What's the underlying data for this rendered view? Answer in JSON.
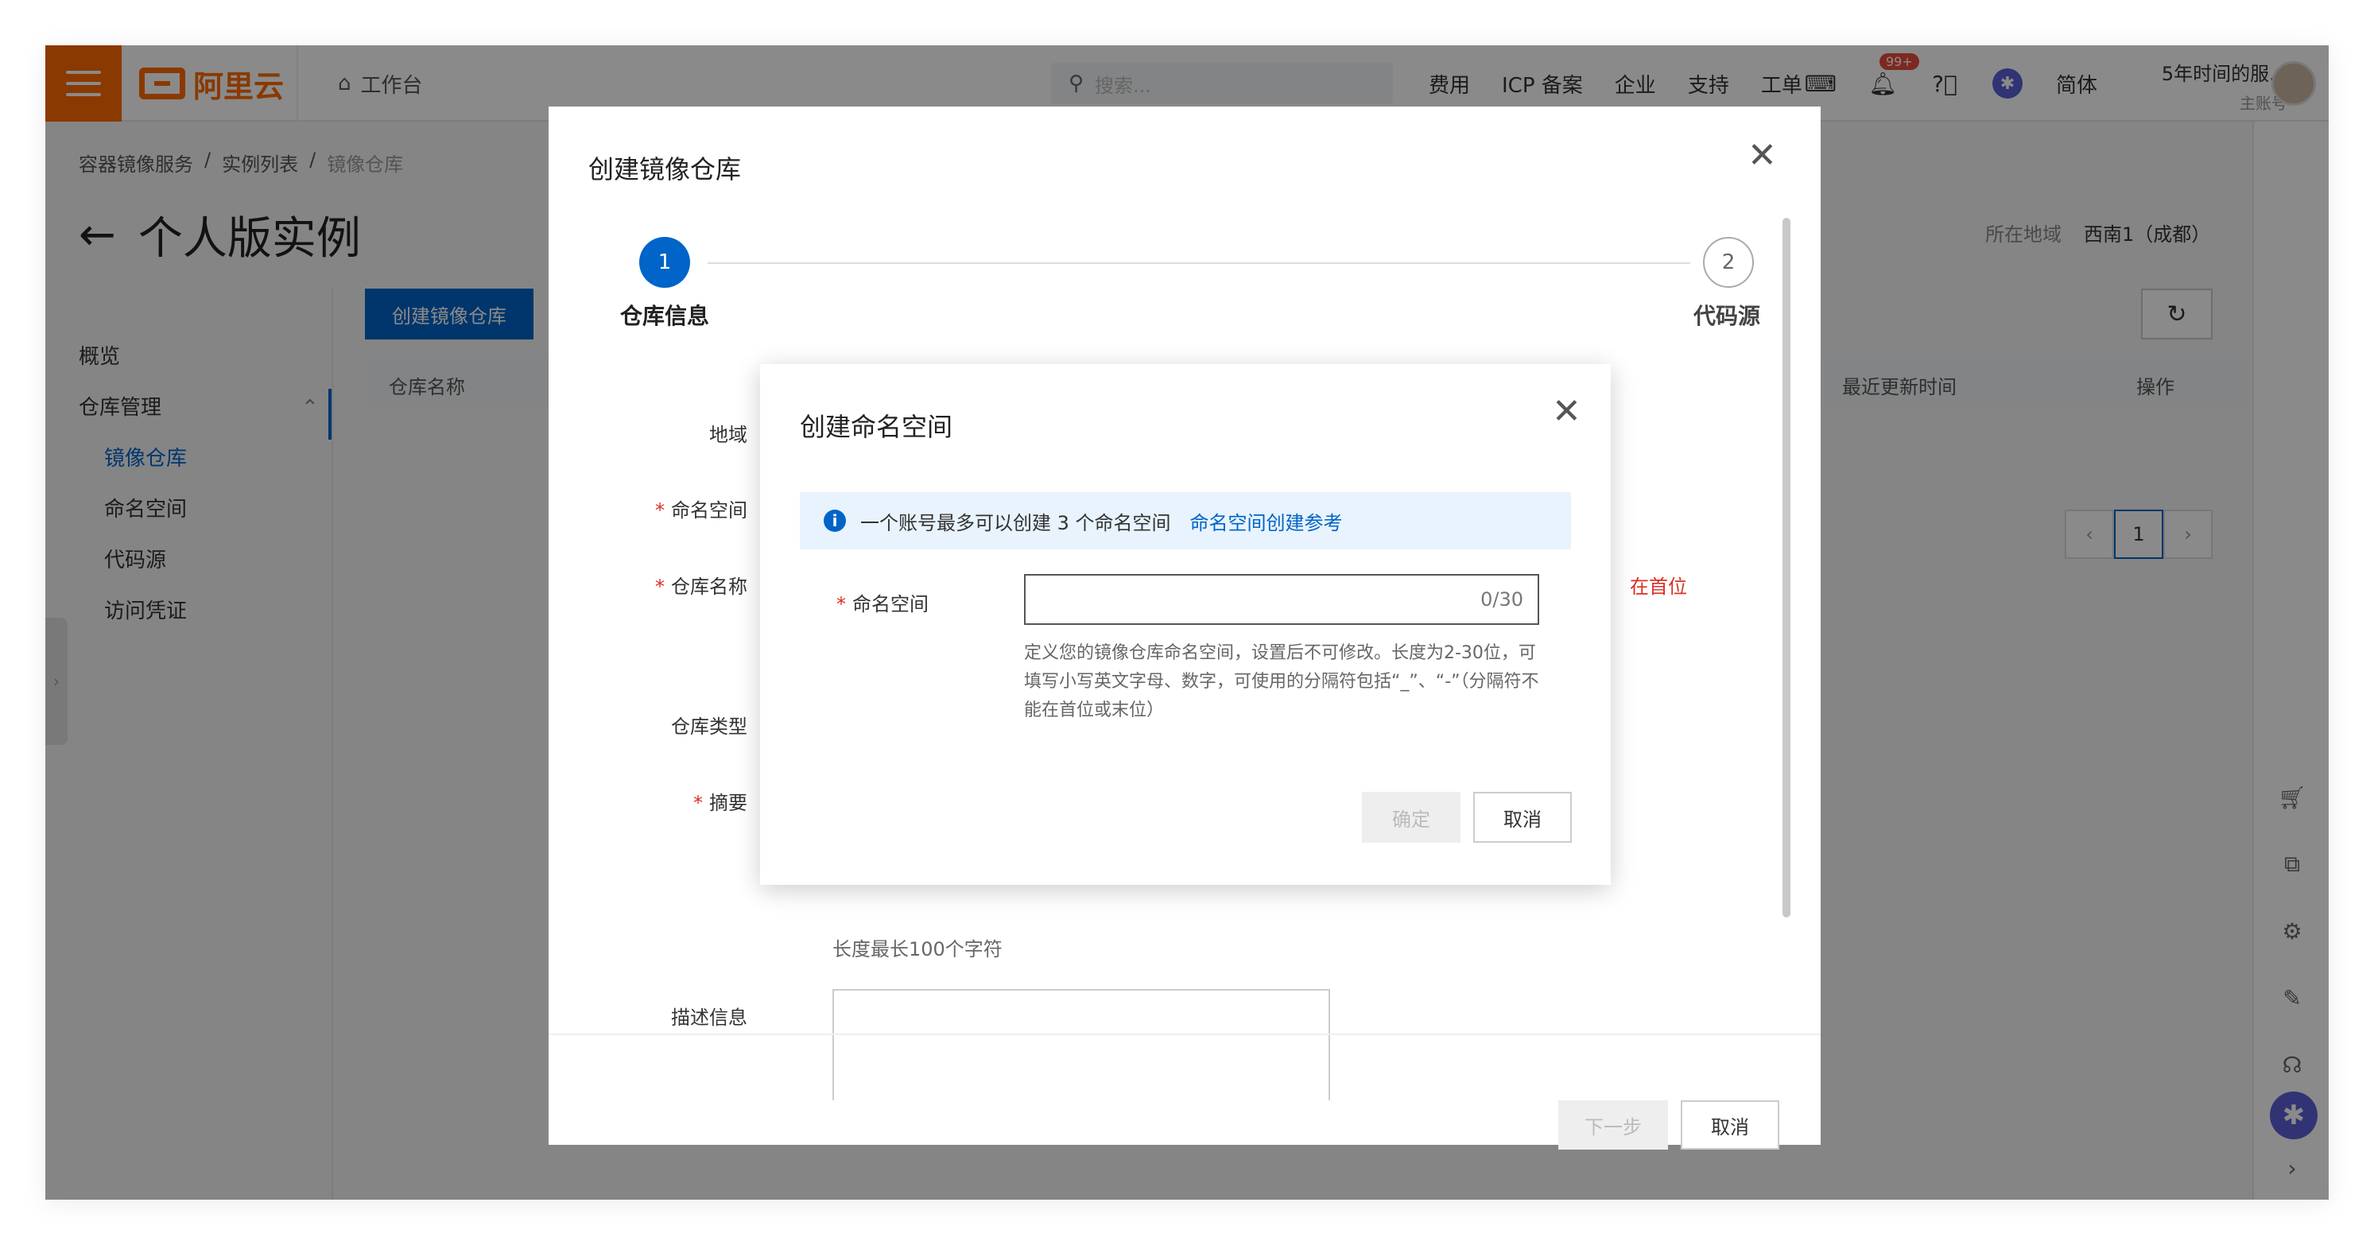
{
  "topbar": {
    "logo_text": "阿里云",
    "workbench": "工作台",
    "search_placeholder": "搜索...",
    "links": [
      "费用",
      "ICP 备案",
      "企业",
      "支持",
      "工单"
    ],
    "notification_badge": "99+",
    "language": "简体",
    "account_name": "5年时间的服...",
    "account_role": "主账号"
  },
  "breadcrumb": [
    "容器镜像服务",
    "/",
    "实例列表",
    "/",
    "镜像仓库"
  ],
  "page": {
    "title": "个人版实例",
    "region_label": "所在地域",
    "region_value": "西南1（成都）",
    "create_repo_button": "创建镜像仓库",
    "table_headers": [
      "仓库名称",
      "最近更新时间",
      "操作"
    ],
    "pager_current": "1"
  },
  "sidebar": {
    "items": [
      {
        "label": "概览"
      },
      {
        "label": "仓库管理"
      },
      {
        "label": "镜像仓库"
      },
      {
        "label": "命名空间"
      },
      {
        "label": "代码源"
      },
      {
        "label": "访问凭证"
      }
    ]
  },
  "dialog_repo": {
    "title": "创建镜像仓库",
    "step1_num": "1",
    "step1_label": "仓库信息",
    "step2_num": "2",
    "step2_label": "代码源",
    "labels": [
      "地域",
      "命名空间",
      "仓库名称",
      "仓库类型",
      "摘要",
      "描述信息"
    ],
    "summary_hint": "长度最长100个字符",
    "partial_red_hint": "在首位",
    "next_button": "下一步",
    "cancel_button": "取消"
  },
  "dialog_ns": {
    "title": "创建命名空间",
    "info_text": "一个账号最多可以创建 3 个命名空间",
    "info_link": "命名空间创建参考",
    "field_label": "命名空间",
    "input_value": "",
    "counter": "0/30",
    "help_text": "定义您的镜像仓库命名空间，设置后不可修改。长度为2-30位，可填写小写英文字母、数字，可使用的分隔符包括“_”、“-”（分隔符不能在首位或末位）",
    "ok_button": "确定",
    "cancel_button": "取消"
  },
  "colors": {
    "brand": "#ff6a00",
    "primary": "#0064c8",
    "required": "#d93026"
  }
}
